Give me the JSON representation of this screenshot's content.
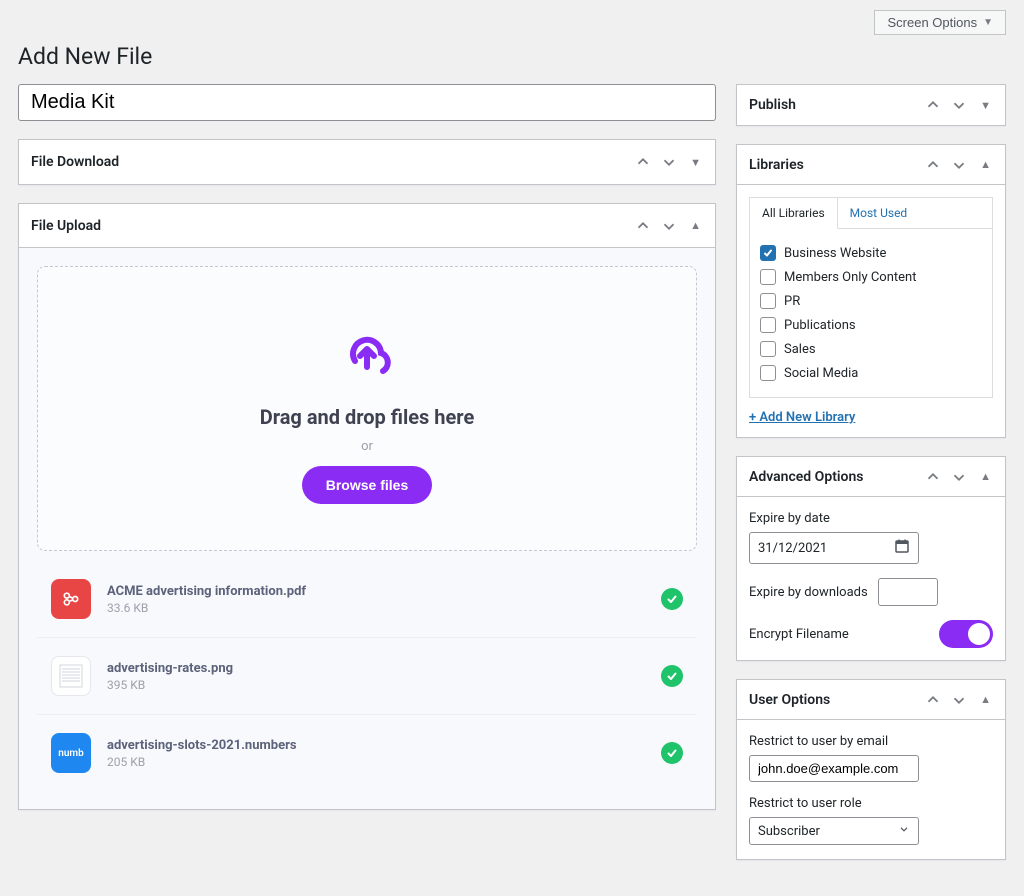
{
  "screen_options_label": "Screen Options",
  "page_title": "Add New File",
  "title_value": "Media Kit",
  "panels": {
    "file_download": "File Download",
    "file_upload": "File Upload",
    "publish": "Publish",
    "libraries": "Libraries",
    "advanced": "Advanced Options",
    "user_options": "User Options"
  },
  "upload": {
    "drop_title": "Drag and drop files here",
    "or": "or",
    "browse": "Browse files",
    "files": [
      {
        "name": "ACME advertising information.pdf",
        "size": "33.6 KB",
        "kind": "pdf"
      },
      {
        "name": "advertising-rates.png",
        "size": "395 KB",
        "kind": "img"
      },
      {
        "name": "advertising-slots-2021.numbers",
        "size": "205 KB",
        "kind": "num"
      }
    ]
  },
  "libraries": {
    "tab_all": "All Libraries",
    "tab_most": "Most Used",
    "items": [
      {
        "label": "Business Website",
        "checked": true
      },
      {
        "label": "Members Only Content",
        "checked": false
      },
      {
        "label": "PR",
        "checked": false
      },
      {
        "label": "Publications",
        "checked": false
      },
      {
        "label": "Sales",
        "checked": false
      },
      {
        "label": "Social Media",
        "checked": false
      }
    ],
    "add_new": "+ Add New Library"
  },
  "advanced": {
    "expire_date_label": "Expire by date",
    "expire_date_value": "31/12/2021",
    "expire_dl_label": "Expire by downloads",
    "encrypt_label": "Encrypt Filename"
  },
  "user_options": {
    "email_label": "Restrict to user by email",
    "email_value": "john.doe@example.com",
    "role_label": "Restrict to user role",
    "role_value": "Subscriber"
  }
}
